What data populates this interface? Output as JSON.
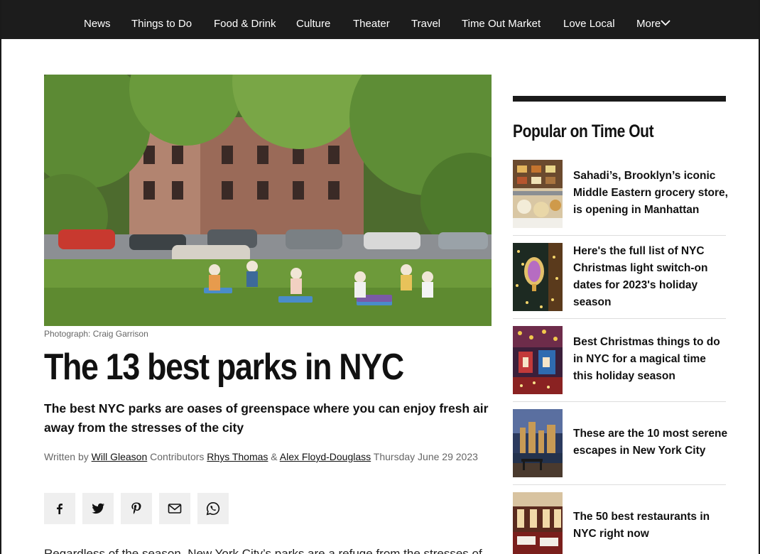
{
  "nav": {
    "items": [
      "News",
      "Things to Do",
      "Food & Drink",
      "Culture",
      "Theater",
      "Travel",
      "Time Out Market",
      "Love Local",
      "More"
    ]
  },
  "article": {
    "photo_credit": "Photograph: Craig Garrison",
    "title": "The 13 best parks in NYC",
    "subtitle": "The best NYC parks are oases of greenspace where you can enjoy fresh air away from the stresses of the city",
    "byline": {
      "written_by_label": "Written by",
      "author": "Will Gleason",
      "contributors_label": "Contributors",
      "contributor_1": "Rhys Thomas",
      "amp": "&",
      "contributor_2": "Alex Floyd-Douglass",
      "date": "Thursday June 29 2023"
    },
    "share_icons": [
      "facebook-icon",
      "twitter-icon",
      "pinterest-icon",
      "email-icon",
      "whatsapp-icon"
    ],
    "body_start": "Regardless of the season, New York City’s parks are a refuge from the stresses of"
  },
  "sidebar": {
    "title": "Popular on Time Out",
    "cards": [
      {
        "text": "Sahadi’s, Brooklyn’s iconic Middle Eastern grocery store, is opening in Manhattan"
      },
      {
        "text": "Here's the full list of NYC Christmas light switch-on dates for 2023's holiday season"
      },
      {
        "text": "Best Christmas things to do in NYC for a magical time this holiday season"
      },
      {
        "text": "These are the 10 most serene escapes in New York City"
      },
      {
        "text": "The 50 best restaurants in NYC right now"
      }
    ]
  },
  "colors": {
    "nav_bg": "#1c1c1c",
    "accent_rule": "#1a1a1a",
    "share_bg": "#efefef"
  }
}
